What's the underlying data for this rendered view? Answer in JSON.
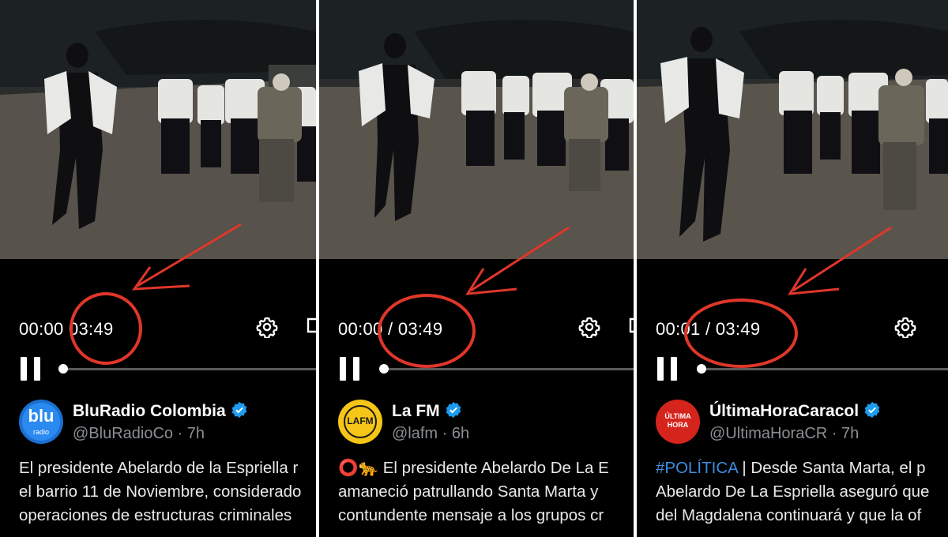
{
  "panels": [
    {
      "time": {
        "current": "00:00",
        "total": "03:49",
        "sep": ""
      },
      "account": {
        "name": "BluRadio Colombia",
        "handle": "@BluRadioCo",
        "age": "· 7h",
        "avatar_text": "blu",
        "avatar_sub": "radio"
      },
      "post_lines": [
        "El presidente Abelardo de la Espriella r",
        "el barrio 11 de Noviembre, considerado",
        "operaciones de estructuras criminales"
      ]
    },
    {
      "time": {
        "current": "00:00",
        "total": "03:49",
        "sep": "/"
      },
      "account": {
        "name": "La FM",
        "handle": "@lafm",
        "age": "· 6h",
        "avatar_text": "LAFM"
      },
      "post_lines": [
        "⭕🐆 El presidente Abelardo De La E",
        "amaneció patrullando Santa Marta y",
        "contundente mensaje a los grupos cr"
      ]
    },
    {
      "time": {
        "current": "00:01",
        "total": "03:49",
        "sep": "/"
      },
      "account": {
        "name": "ÚltimaHoraCaracol",
        "handle": "@UltimaHoraCR",
        "age": "· 7h",
        "avatar_text": "ÚLTIMA HORA"
      },
      "hashtag": "#POLÍTICA",
      "post_lines": [
        " | Desde Santa Marta, el p",
        "Abelardo De La Espriella aseguró que",
        "del Magdalena continuará y que la of"
      ]
    }
  ],
  "colors": {
    "highlight": "#e0362a",
    "verified": "#1d9bf0",
    "bg": "#000000"
  },
  "icons": [
    "gear-icon",
    "fullscreen-icon",
    "pause-icon",
    "verified-badge-icon"
  ]
}
